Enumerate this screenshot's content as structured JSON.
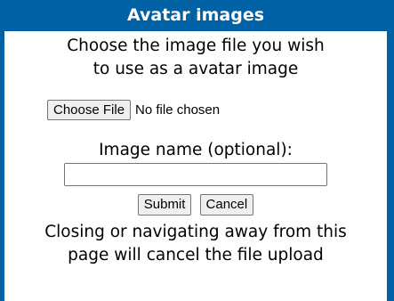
{
  "dialog": {
    "title": "Avatar images",
    "instruction_line1": "Choose the image file you wish",
    "instruction_line2": "to use as a avatar image",
    "file_input": {
      "button_label": "Choose File",
      "status": "No file chosen"
    },
    "name_label": "Image name (optional):",
    "name_input_value": "",
    "submit_label": "Submit",
    "cancel_label": "Cancel",
    "warning_line1": "Closing or navigating away from this",
    "warning_line2": "page will cancel the file upload"
  },
  "colors": {
    "titlebar_bg": "#0061a4",
    "titlebar_text": "#ffffff",
    "body_bg": "#ffffff"
  }
}
